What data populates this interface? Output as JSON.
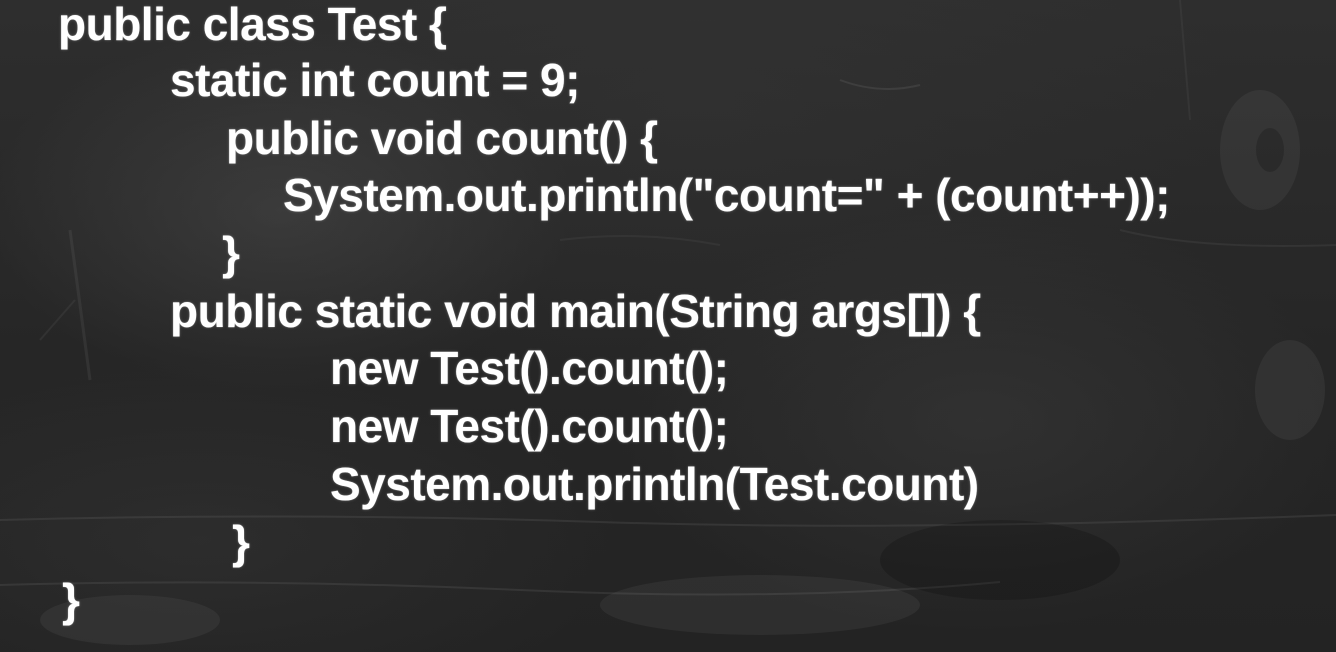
{
  "slide": {
    "background_color": "#2b2b2b",
    "text_color": "#ffffff",
    "code_lines": [
      "public class Test {",
      "static int count = 9;",
      "public void count() {",
      "System.out.println(\"count=\" + (count++));",
      "}",
      "public static void main(String args[]) {",
      "new Test().count();",
      "new Test().count();",
      "System.out.println(Test.count)",
      "}",
      "}"
    ]
  }
}
